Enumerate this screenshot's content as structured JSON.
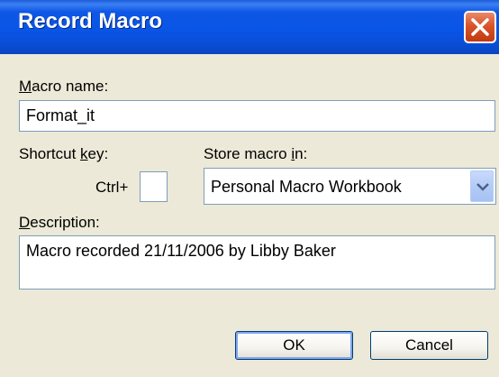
{
  "window": {
    "title": "Record Macro"
  },
  "macro_name": {
    "label_mnemonic": "M",
    "label_rest": "acro name:",
    "value": "Format_it"
  },
  "shortcut": {
    "label_pre": "Shortcut ",
    "label_mnemonic": "k",
    "label_post": "ey:",
    "prefix": "Ctrl+",
    "value": ""
  },
  "store": {
    "label_pre": "Store macro ",
    "label_mnemonic": "i",
    "label_post": "n:",
    "selected": "Personal Macro Workbook"
  },
  "description": {
    "label_mnemonic": "D",
    "label_rest": "escription:",
    "value": "Macro recorded 21/11/2006 by Libby Baker"
  },
  "buttons": {
    "ok": "OK",
    "cancel": "Cancel"
  }
}
